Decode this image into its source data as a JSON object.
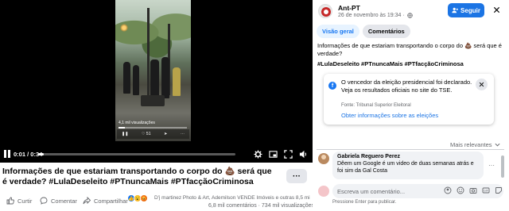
{
  "video": {
    "current_time": "0:01",
    "duration": "0:34",
    "progress_fraction": 0.03,
    "phone_overlay_text": "4,1 mil visualizações",
    "phone_count": "51"
  },
  "post": {
    "caption": "Informações de que estariam transportando o corpo do 💩 será que é verdade? #LulaDeseleito #PTnuncaMais #PTfacçãoCriminosa",
    "more_label": "···",
    "reactors": "D'j martinez Photo & Art, Ademilson VENDE Imóveis e outras 8,5 mil pe...",
    "stats": "6,8 mil comentários · 734 mil visualizações",
    "reactions": [
      "like",
      "wow",
      "angry"
    ],
    "actions": {
      "like": "Curtir",
      "comment": "Comentar",
      "share": "Compartilhar"
    }
  },
  "panel": {
    "page_name": "Ant-PT",
    "date": "26 de novembro às 19:34 ·",
    "follow_label": "Seguir",
    "tabs": [
      {
        "label": "Visão geral",
        "active": true
      },
      {
        "label": "Comentários",
        "active": false
      }
    ],
    "description": "Informações de que estariam transportando o corpo do 💩 será que é verdade?",
    "hashtags": "#LulaDeseleito #PTnuncaMais #PTfacçãoCriminosa",
    "notice": {
      "message": "O vencedor da eleição presidencial foi declarado. Veja os resultados oficiais no site do TSE.",
      "source": "Fonte: Tribunal Superior Eleitoral",
      "link": "Obter informações sobre as eleições"
    },
    "sort_label": "Mais relevantes",
    "comment": {
      "author": "Gabriela Reguero Perez",
      "text": "Dêem um Google é um video de duas semanas atrás e foi sim da Gal Costa"
    },
    "comment_more": "···",
    "comment_placeholder": "Escreva um comentário...",
    "enter_hint": "Pressione Enter para publicar."
  },
  "colors": {
    "accent": "#1877f2",
    "follow_button": "#1b74e4",
    "tab_active_bg": "#e7f3ff",
    "muted_text": "#65676b"
  }
}
